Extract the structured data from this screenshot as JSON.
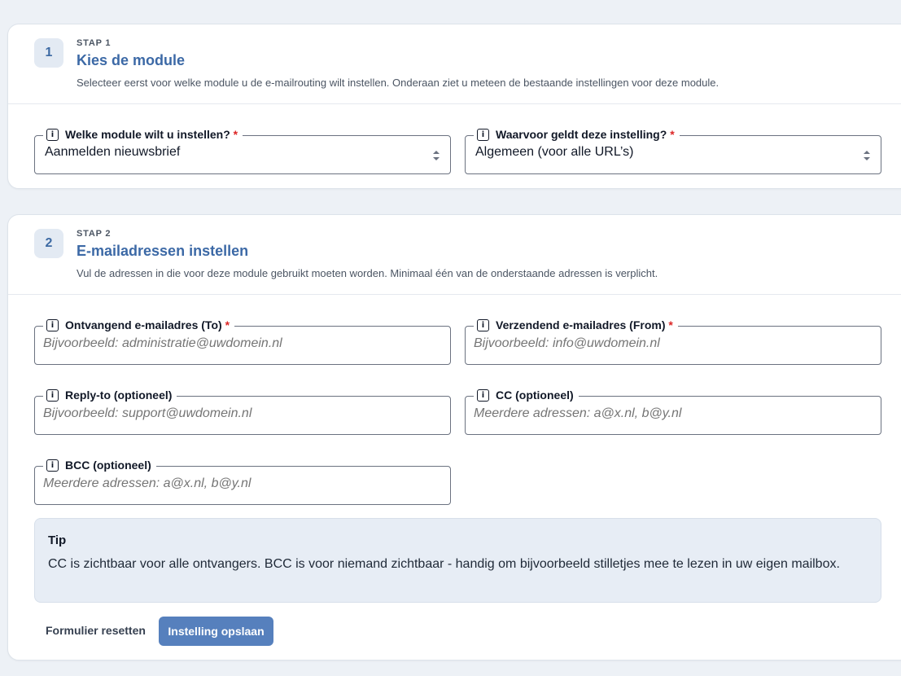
{
  "step1": {
    "badge": "1",
    "label": "STAP 1",
    "title": "Kies de module",
    "description": "Selecteer eerst voor welke module u de e-mailrouting wilt instellen. Onderaan ziet u meteen de bestaande instellingen voor deze module.",
    "module_field": {
      "label": "Welke module wilt u instellen?",
      "required": "*",
      "value": "Aanmelden nieuwsbrief"
    },
    "scope_field": {
      "label": "Waarvoor geldt deze instelling?",
      "required": "*",
      "value": "Algemeen (voor alle URL’s)"
    }
  },
  "step2": {
    "badge": "2",
    "label": "STAP 2",
    "title": "E-mailadressen instellen",
    "description": "Vul de adressen in die voor deze module gebruikt moeten worden. Minimaal één van de onderstaande adressen is verplicht.",
    "to_field": {
      "label": "Ontvangend e-mailadres (To)",
      "required": "*",
      "placeholder": "Bijvoorbeeld: administratie@uwdomein.nl"
    },
    "from_field": {
      "label": "Verzendend e-mailadres (From)",
      "required": "*",
      "placeholder": "Bijvoorbeeld: info@uwdomein.nl"
    },
    "replyto_field": {
      "label": "Reply-to (optioneel)",
      "placeholder": "Bijvoorbeeld: support@uwdomein.nl"
    },
    "cc_field": {
      "label": "CC (optioneel)",
      "placeholder": "Meerdere adressen: a@x.nl, b@y.nl"
    },
    "bcc_field": {
      "label": "BCC (optioneel)",
      "placeholder": "Meerdere adressen: a@x.nl, b@y.nl"
    },
    "tip": {
      "title": "Tip",
      "text": "CC is zichtbaar voor alle ontvangers. BCC is voor niemand zichtbaar - handig om bijvoorbeeld stilletjes mee te lezen in uw eigen mailbox."
    },
    "reset_label": "Formulier resetten",
    "save_label": "Instelling opslaan"
  },
  "icons": {
    "info": "info-icon",
    "select": "select-arrows-icon"
  },
  "colors": {
    "accent": "#3c69a6",
    "button": "#5680bd",
    "required": "#dc2626",
    "background": "#edf1f6"
  }
}
